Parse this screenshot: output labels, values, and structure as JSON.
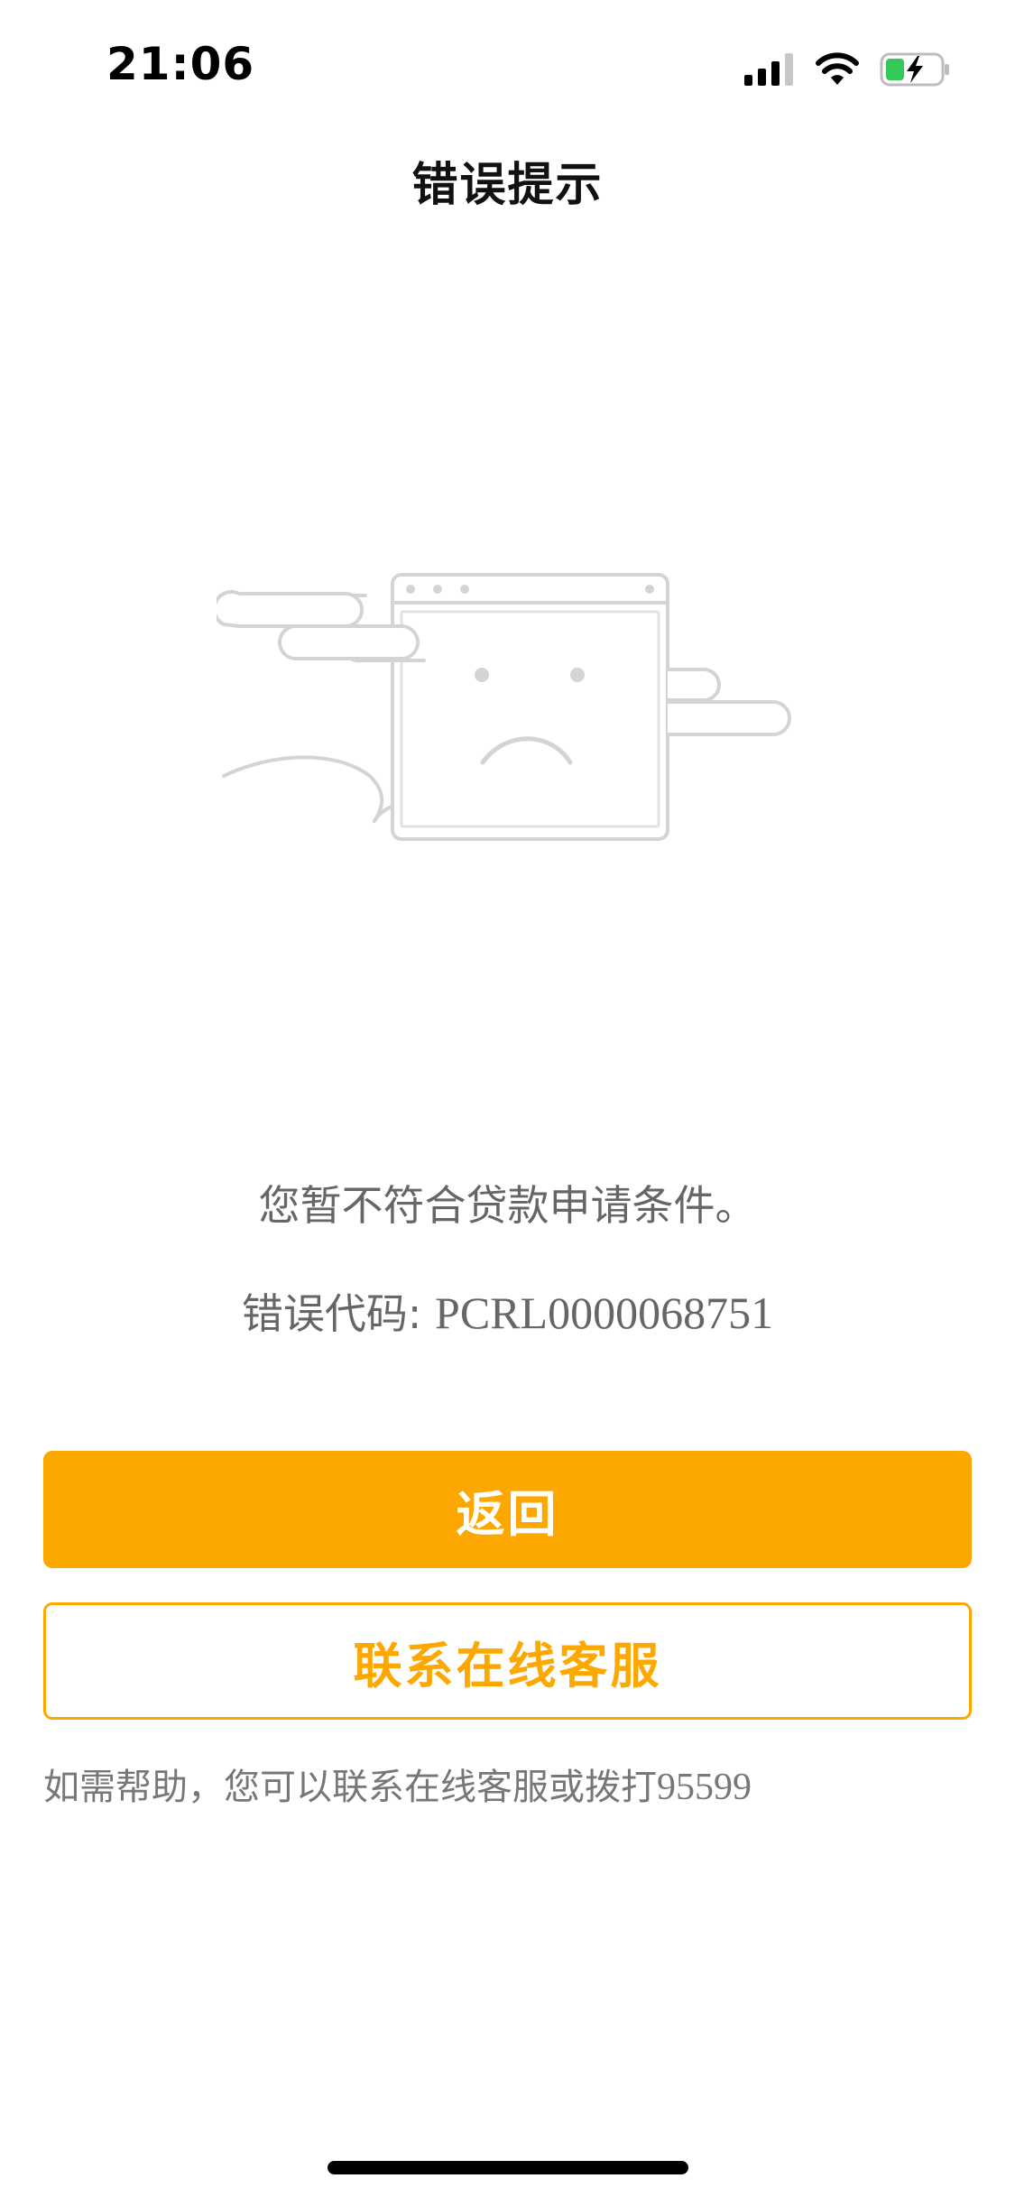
{
  "status_bar": {
    "time": "21:06",
    "icons": [
      "signal-icon",
      "wifi-icon",
      "battery-charging-icon"
    ],
    "battery_color": "#34c759"
  },
  "nav": {
    "title": "错误提示"
  },
  "illustration": {
    "icon": "sad-browser-window-icon",
    "line_color": "#d4d4d4"
  },
  "messages": {
    "primary": "您暂不符合贷款申请条件。",
    "code_label": "错误代码: ",
    "code_value": "PCRL0000068751"
  },
  "buttons": {
    "back_label": "返回",
    "contact_label": "联系在线客服"
  },
  "help": {
    "text": "如需帮助，您可以联系在线客服或拨打",
    "phone": "95599"
  },
  "colors": {
    "accent": "#fda800",
    "text_secondary": "#666666"
  }
}
